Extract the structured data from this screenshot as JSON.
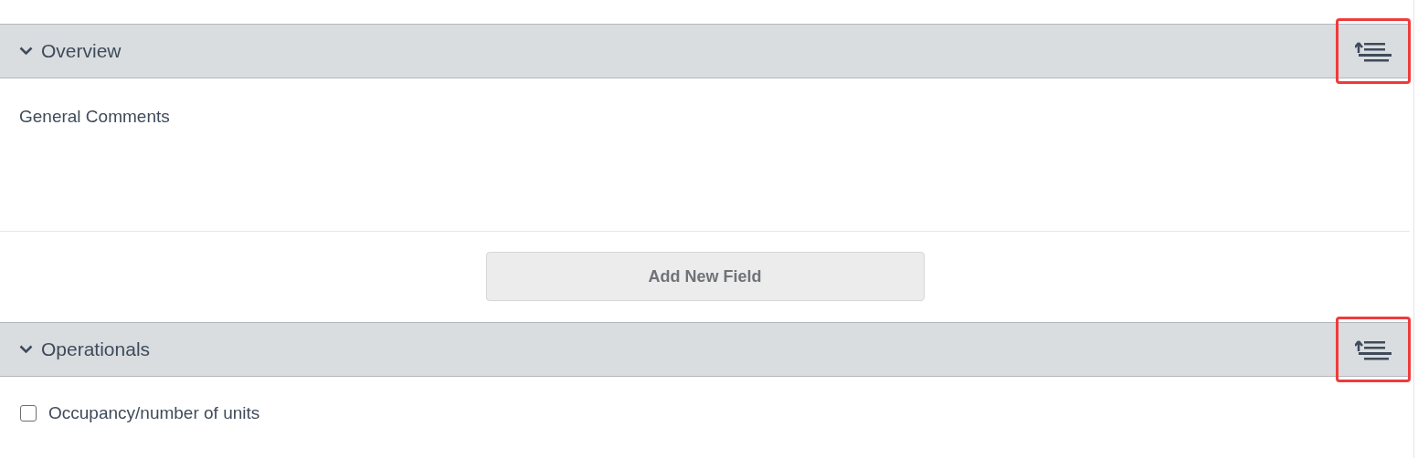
{
  "sections": [
    {
      "title": "Overview",
      "expanded": true,
      "highlighted": true,
      "fields": [
        {
          "kind": "comment",
          "label": "General Comments"
        }
      ],
      "add_button": "Add New Field"
    },
    {
      "title": "Operationals",
      "expanded": true,
      "highlighted": true,
      "fields": [
        {
          "kind": "checkbox",
          "label": "Occupancy/number of units",
          "checked": false
        }
      ]
    }
  ]
}
